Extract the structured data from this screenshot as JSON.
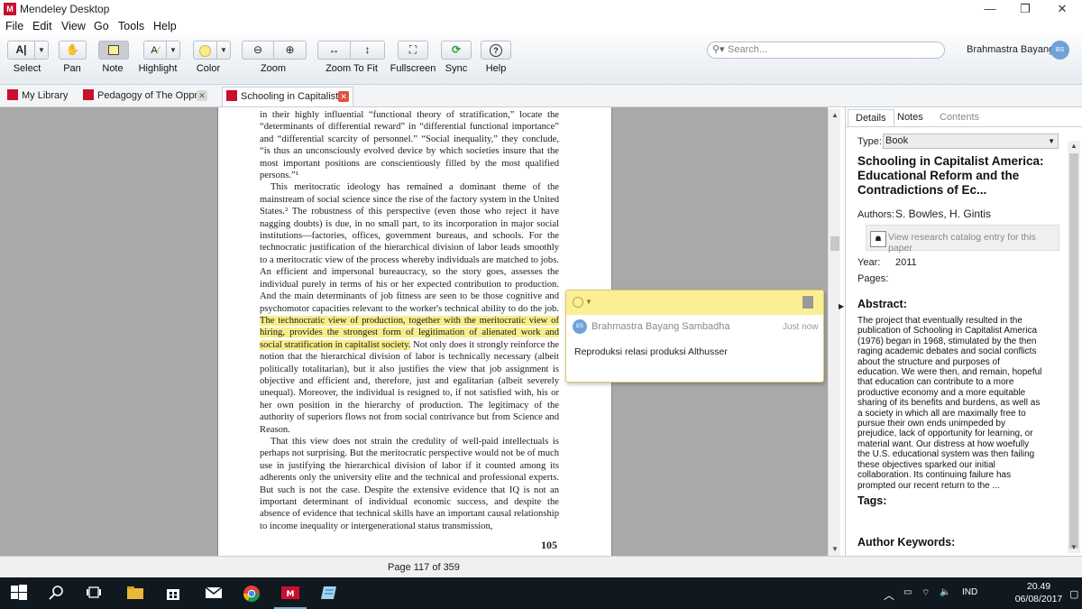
{
  "window": {
    "title": "Mendeley Desktop",
    "minimize": "—",
    "maximize": "❐",
    "close": "✕"
  },
  "menu": [
    "File",
    "Edit",
    "View",
    "Go",
    "Tools",
    "Help"
  ],
  "toolbar": {
    "select": "Select",
    "pan": "Pan",
    "note": "Note",
    "highlight": "Highlight",
    "color": "Color",
    "zoom": "Zoom",
    "zoom_to_fit": "Zoom To Fit",
    "fullscreen": "Fullscreen",
    "sync": "Sync",
    "help": "Help",
    "search_placeholder": "Search...",
    "user_name": "Brahmastra Bayang",
    "user_initials": "BS",
    "highlight_color": "#f7ee8a"
  },
  "tabs": [
    {
      "label": "My Library",
      "icon": "mendeley-icon"
    },
    {
      "label": "Pedagogy of The Oppr...",
      "icon": "pdf-icon"
    },
    {
      "label": "Schooling in Capitalist ...",
      "icon": "pdf-icon",
      "active": true
    }
  ],
  "pdf": {
    "paragraphs": [
      {
        "indent": false,
        "parts": [
          {
            "t": "in their highly influential “functional theory of stratification,” locate the “determinants of differential reward” in “differential functional importance” and “differential scarcity of personnel.” “Social inequality,” they conclude, “is thus an unconsciously evolved device by which societies insure that the most important positions are conscientiously filled by the most qualified persons.”¹",
            "hl": false
          }
        ]
      },
      {
        "indent": true,
        "parts": [
          {
            "t": "This meritocratic ideology has remained a dominant theme of the mainstream of social science since the rise of the factory system in the United States.² The robustness of this perspective (even those who reject it have nagging doubts) is due, in no small part, to its incorporation in major social institutions—factories, offices, government bureaus, and schools. For the technocratic justification of the hierarchical division of labor leads smoothly to a meritocratic view of the process whereby individuals are matched to jobs. An efficient and impersonal bureaucracy, so the story goes, assesses the individual purely in terms of his or her expected contribution to production. And the main determinants of job fitness are seen to be those cognitive and psychomotor capacities relevant to the worker's technical ability to do the job. ",
            "hl": false
          },
          {
            "t": "The technocratic view of production, together with the meritocratic view of hiring, provides the strongest form of legitimation of alienated work and social stratification in capitalist society.",
            "hl": true
          },
          {
            "t": " Not only does it strongly reinforce the notion that the hierarchical division of labor is technically necessary (albeit politically totalitarian), but it also justifies the view that job assignment is objective and efficient and, therefore, just and egalitarian (albeit severely unequal). Moreover, the individual is resigned to, if not satisfied with, his or her own position in the hierarchy of production. The legitimacy of the authority of superiors flows not from social contrivance but from Science and Reason.",
            "hl": false
          }
        ]
      },
      {
        "indent": true,
        "parts": [
          {
            "t": "That this view does not strain the credulity of well-paid intellectuals is perhaps not surprising. But the meritocratic perspective would not be of much use in justifying the hierarchical division of labor if it counted among its adherents only the university elite and the technical and professional experts. But such is not the case. Despite the extensive evidence that IQ is not an important determinant of individual economic success, and despite the absence of evidence that technical skills have an important causal relationship to income inequality or intergenerational status transmission,",
            "hl": false
          }
        ]
      }
    ],
    "page_number": "105"
  },
  "note": {
    "author": "Brahmastra Bayang Sambadha",
    "initials": "BS",
    "time": "Just now",
    "body": "Reproduksi relasi produksi Althusser"
  },
  "details": {
    "tabs": [
      "Details",
      "Notes",
      "Contents"
    ],
    "type_label": "Type:",
    "type_value": "Book",
    "title": "Schooling in Capitalist America: Educational Reform and the Contradictions of Ec...",
    "authors_label": "Authors:",
    "authors_value": "S. Bowles, H. Gintis",
    "catalog_button": "View research catalog entry for this paper",
    "year_label": "Year:",
    "year_value": "2011",
    "pages_label": "Pages:",
    "abstract_heading": "Abstract:",
    "abstract": "The project that eventually resulted in the publication of Schooling in Capitalist America (1976) began in 1968, stimulated by the then raging academic debates and social conflicts about the structure and purposes of education. We were then, and remain, hopeful that education can contribute to a more productive economy and a more equitable sharing of its benefits and burdens, as well as a society in which all are maximally free to pursue their own ends unimpeded by prejudice, lack of opportunity for learning, or material want. Our distress at how woefully the U.S. educational system was then failing these objectives sparked our initial collaboration. Its continuing failure has prompted our recent return to the ...",
    "tags_heading": "Tags:",
    "keywords_heading": "Author Keywords:"
  },
  "status": {
    "page": "Page 117 of 359"
  },
  "taskbar": {
    "language": "IND",
    "time": "20.49",
    "date": "06/08/2017"
  }
}
